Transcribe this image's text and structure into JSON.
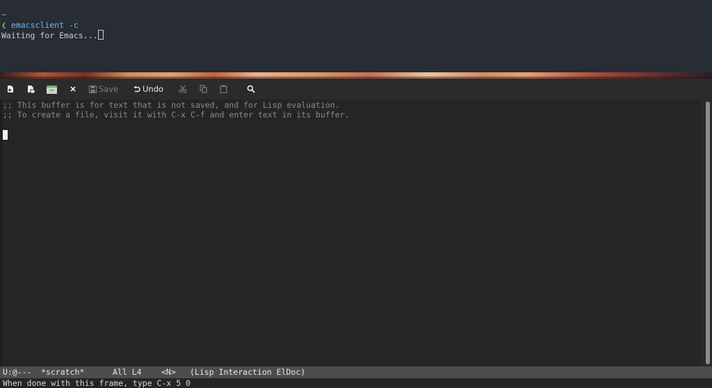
{
  "terminal": {
    "directory": "~",
    "prompt_symbol": "❮",
    "command": "emacsclient -c",
    "status": "Waiting for Emacs..."
  },
  "toolbar": {
    "buttons": [
      {
        "name": "new-file",
        "icon": "new-file-icon",
        "label": "",
        "enabled": true
      },
      {
        "name": "open-file",
        "icon": "open-file-icon",
        "label": "",
        "enabled": true
      },
      {
        "name": "open-directory",
        "icon": "folder-icon",
        "label": "",
        "enabled": true
      },
      {
        "name": "close-buffer",
        "icon": "close-icon",
        "label": "",
        "enabled": true
      },
      {
        "name": "save",
        "icon": "save-icon",
        "label": "Save",
        "enabled": false
      },
      {
        "name": "undo",
        "icon": "undo-icon",
        "label": "Undo",
        "enabled": true
      },
      {
        "name": "cut",
        "icon": "cut-icon",
        "label": "",
        "enabled": false
      },
      {
        "name": "copy",
        "icon": "copy-icon",
        "label": "",
        "enabled": false
      },
      {
        "name": "paste",
        "icon": "paste-icon",
        "label": "",
        "enabled": false
      },
      {
        "name": "search",
        "icon": "search-icon",
        "label": "",
        "enabled": true
      }
    ]
  },
  "buffer": {
    "lines": [
      ";; This buffer is for text that is not saved, and for Lisp evaluation.",
      ";; To create a file, visit it with C-x C-f and enter text in its buffer."
    ]
  },
  "mode_line": {
    "state": "U:@---",
    "buffer_name": "*scratch*",
    "position": "All L4",
    "evil_state": "<N>",
    "modes": "(Lisp Interaction ElDoc)"
  },
  "echo_area": {
    "message": "When done with this frame, type C-x 5 0"
  },
  "colors": {
    "terminal_bg": "#272c35",
    "prompt": "#7cc46a",
    "command": "#6fb4f2",
    "emacs_bg": "#252525",
    "comment": "#8a8a8a",
    "mode_line_bg": "#4d4d4d"
  }
}
